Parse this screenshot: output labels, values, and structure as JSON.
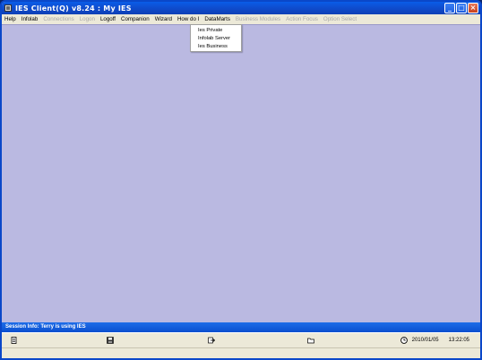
{
  "window": {
    "title": "IES Client(Q) v8.24 : My IES"
  },
  "title_buttons": {
    "minimize": "_",
    "maximize": "□",
    "close": "×"
  },
  "menu": [
    {
      "label": "Help",
      "enabled": true
    },
    {
      "label": "Infolab",
      "enabled": true
    },
    {
      "label": "Connections",
      "enabled": false
    },
    {
      "label": "Logon",
      "enabled": false
    },
    {
      "label": "Logoff",
      "enabled": true
    },
    {
      "label": "Companion",
      "enabled": true
    },
    {
      "label": "Wizard",
      "enabled": true
    },
    {
      "label": "How do I",
      "enabled": true
    },
    {
      "label": "DataMarts",
      "enabled": true
    },
    {
      "label": "Business Modules",
      "enabled": false
    },
    {
      "label": "Action Focus",
      "enabled": false
    },
    {
      "label": "Option Select",
      "enabled": false
    }
  ],
  "datamarts_menu": {
    "items": [
      "Ies Private",
      "Infolab Server",
      "Ies Business"
    ]
  },
  "session": {
    "info": "Session Info: Terry is using IES"
  },
  "status": {
    "date": "2010/01/05",
    "time": "13:22:05"
  },
  "icons": [
    "document-icon",
    "save-icon",
    "export-icon",
    "folder-icon",
    "clock-icon"
  ]
}
